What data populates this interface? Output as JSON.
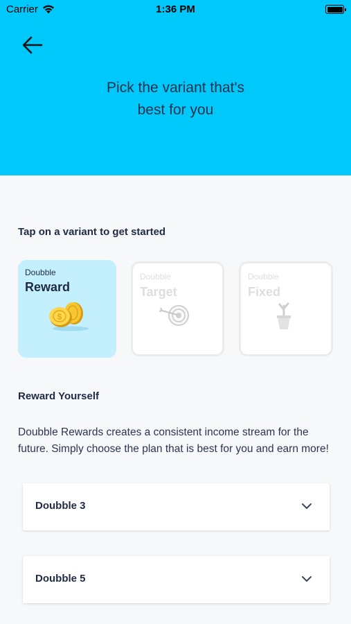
{
  "status_bar": {
    "carrier": "Carrier",
    "time": "1:36 PM"
  },
  "header": {
    "title_line1": "Pick the variant that's",
    "title_line2": "best for you",
    "background_color": "#00c8fa",
    "back_icon": "arrow-left-icon"
  },
  "variants": {
    "prompt": "Tap on a variant to get started",
    "items": [
      {
        "brand": "Doubble",
        "name": "Reward",
        "icon": "coins-icon",
        "selected": true
      },
      {
        "brand": "Doubble",
        "name": "Target",
        "icon": "target-icon",
        "selected": false
      },
      {
        "brand": "Doubble",
        "name": "Fixed",
        "icon": "plant-icon",
        "selected": false
      }
    ],
    "selected_color": "#c4effd"
  },
  "reward": {
    "title": "Reward Yourself",
    "description": "Doubble Rewards creates a consistent income stream for the future. Simply choose the plan that is best for you and earn more!"
  },
  "plans": [
    {
      "label": "Doubble 3",
      "icon": "chevron-down-icon"
    },
    {
      "label": "Doubble 5",
      "icon": "chevron-down-icon"
    }
  ]
}
